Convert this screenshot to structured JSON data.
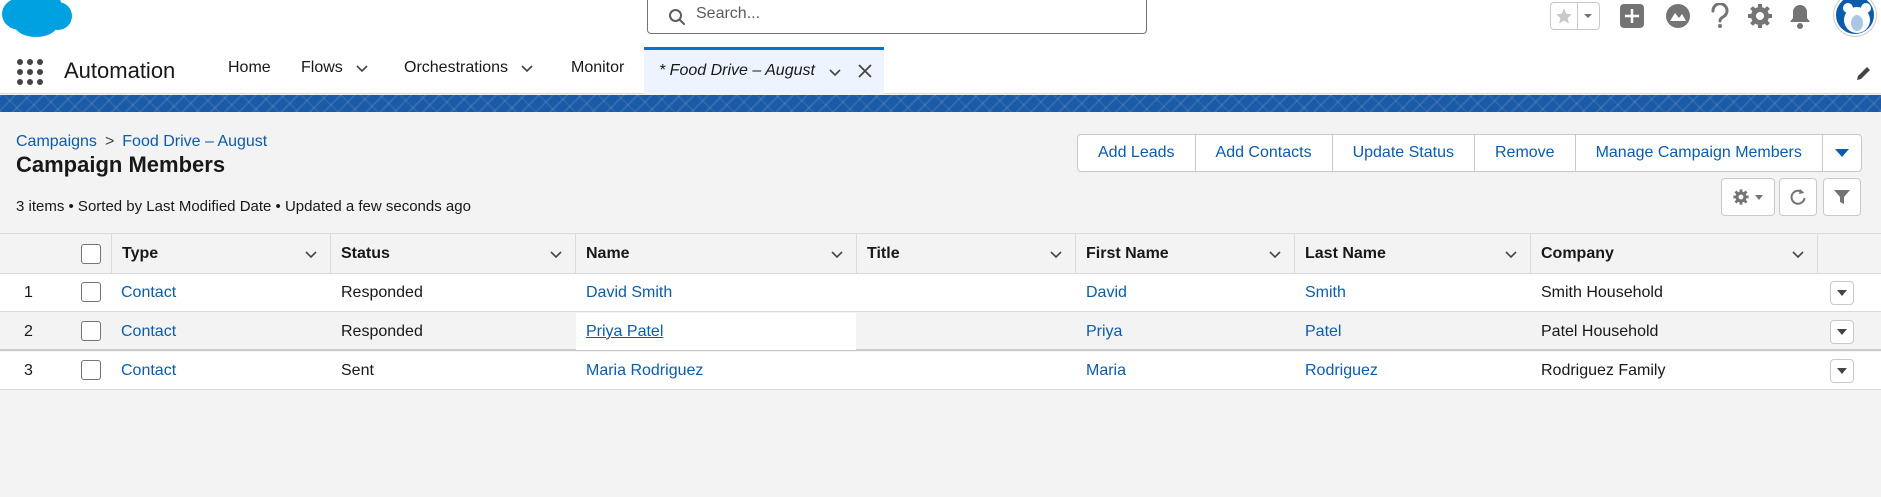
{
  "header": {
    "search_placeholder": "Search..."
  },
  "nav": {
    "app_name": "Automation",
    "items": [
      {
        "label": "Home"
      },
      {
        "label": "Flows"
      },
      {
        "label": "Orchestrations"
      },
      {
        "label": "Monitor"
      }
    ],
    "active_tab": {
      "label": "* Food Drive – August"
    }
  },
  "page": {
    "breadcrumb": {
      "parent": "Campaigns",
      "separator": ">",
      "current": "Food Drive – August"
    },
    "title": "Campaign Members",
    "meta": "3 items • Sorted by Last Modified Date • Updated a few seconds ago",
    "actions": {
      "add_leads": "Add Leads",
      "add_contacts": "Add Contacts",
      "update_status": "Update Status",
      "remove": "Remove",
      "manage_members": "Manage Campaign Members"
    }
  },
  "table": {
    "columns": {
      "type": "Type",
      "status": "Status",
      "name": "Name",
      "title": "Title",
      "first_name": "First Name",
      "last_name": "Last Name",
      "company": "Company"
    },
    "rows": [
      {
        "num": "1",
        "type": "Contact",
        "status": "Responded",
        "name": "David Smith",
        "title": "",
        "first_name": "David",
        "last_name": "Smith",
        "company": "Smith Household"
      },
      {
        "num": "2",
        "type": "Contact",
        "status": "Responded",
        "name": "Priya Patel",
        "title": "",
        "first_name": "Priya",
        "last_name": "Patel",
        "company": "Patel Household"
      },
      {
        "num": "3",
        "type": "Contact",
        "status": "Sent",
        "name": "Maria Rodriguez",
        "title": "",
        "first_name": "Maria",
        "last_name": "Rodriguez",
        "company": "Rodriguez Family"
      }
    ]
  },
  "colors": {
    "brand_blue": "#0176d3",
    "link_blue": "#0b5cab",
    "band_blue": "#1b5aa6",
    "icon_gray": "#747474"
  }
}
